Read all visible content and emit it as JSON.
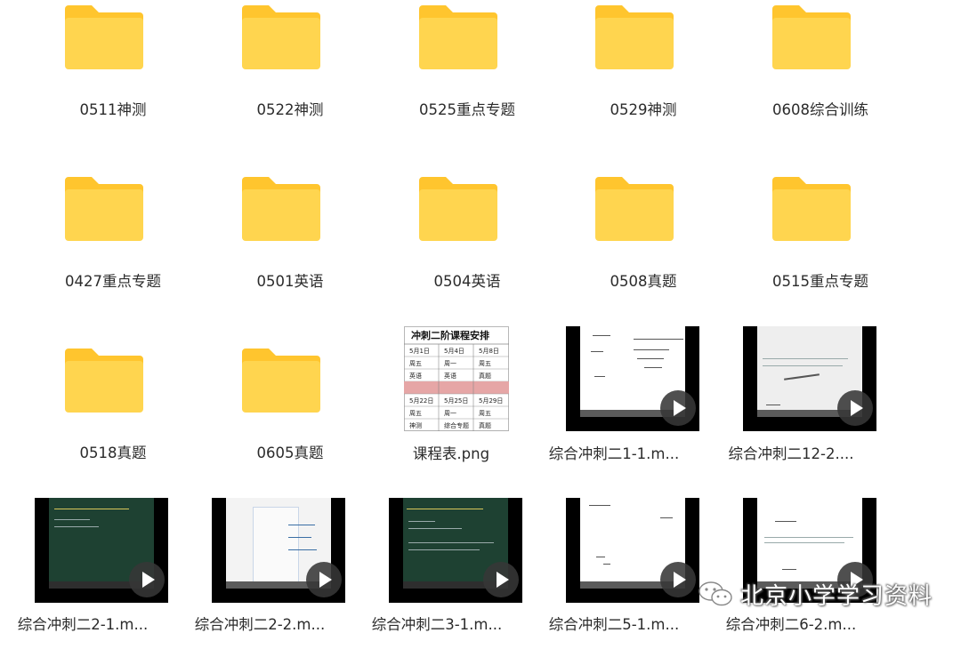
{
  "items": [
    {
      "type": "folder",
      "label": "0511神测"
    },
    {
      "type": "folder",
      "label": "0522神测"
    },
    {
      "type": "folder",
      "label": "0525重点专题"
    },
    {
      "type": "folder",
      "label": "0529神测"
    },
    {
      "type": "folder",
      "label": "0608综合训练"
    },
    {
      "type": "folder",
      "label": "0427重点专题"
    },
    {
      "type": "folder",
      "label": "0501英语"
    },
    {
      "type": "folder",
      "label": "0504英语"
    },
    {
      "type": "folder",
      "label": "0508真题"
    },
    {
      "type": "folder",
      "label": "0515重点专题"
    },
    {
      "type": "folder",
      "label": "0518真题"
    },
    {
      "type": "folder",
      "label": "0605真题"
    },
    {
      "type": "image",
      "label": "课程表.png"
    },
    {
      "type": "video",
      "label": "综合冲刺二1-1.m..."
    },
    {
      "type": "video",
      "label": "综合冲刺二12-2...."
    },
    {
      "type": "video",
      "label": "综合冲刺二2-1.m..."
    },
    {
      "type": "video",
      "label": "综合冲刺二2-2.m..."
    },
    {
      "type": "video",
      "label": "综合冲刺二3-1.m..."
    },
    {
      "type": "video",
      "label": "综合冲刺二5-1.m..."
    },
    {
      "type": "video",
      "label": "综合冲刺二6-2.m..."
    }
  ],
  "schedule_thumb": {
    "title": "冲刺二阶课程安排",
    "rows": [
      [
        "5月1日",
        "5月4日",
        "5月8日"
      ],
      [
        "周五",
        "周一",
        "周五"
      ],
      [
        "英语",
        "英语",
        "真题"
      ],
      [
        "",
        "",
        ""
      ],
      [
        "5月22日",
        "5月25日",
        "5月29日"
      ],
      [
        "周五",
        "周一",
        "周五"
      ],
      [
        "神测",
        "综合专题",
        "真题"
      ]
    ]
  },
  "watermark": {
    "text": "北京小学学习资料",
    "icon": "wechat-icon"
  },
  "colors": {
    "folder_front": "#ffd54f",
    "folder_back": "#ffc52e",
    "label": "#2b2b2b"
  }
}
